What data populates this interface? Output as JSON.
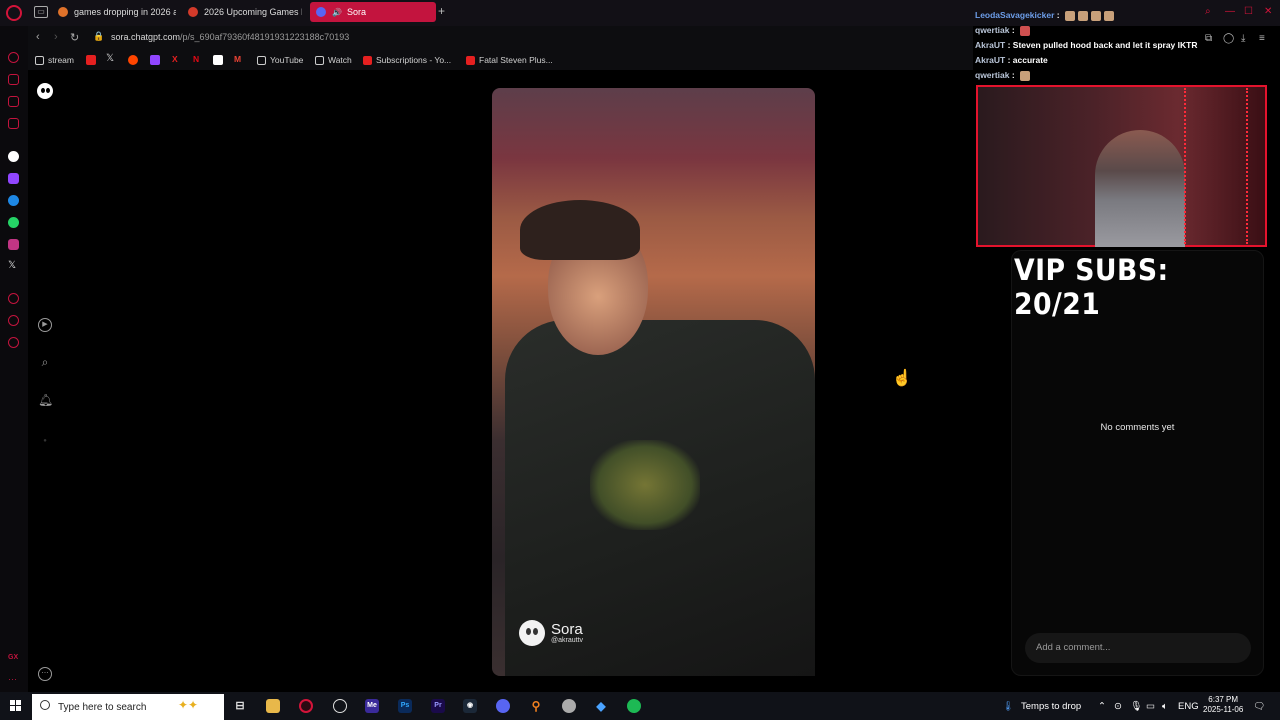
{
  "browser": {
    "tabs": [
      {
        "label": "games dropping in 2026 a",
        "icon": "reddit-icon",
        "color": "#e0722a"
      },
      {
        "label": "2026 Upcoming Games R",
        "icon": "gamespot-icon",
        "color": "#d33a2a"
      },
      {
        "label": "Sora",
        "icon": "discord-icon",
        "color": "#5865f2",
        "audio_icon": "speaker-icon"
      }
    ],
    "url_host": "sora.chatgpt.com",
    "url_path": "/p/s_690af79360f48191931223188c70193",
    "bookmarks": [
      {
        "label": "stream",
        "icon": "folder-icon"
      },
      {
        "label": "YouTube",
        "icon": "folder-icon"
      },
      {
        "label": "Watch",
        "icon": "folder-icon"
      },
      {
        "label": "Subscriptions - Yo...",
        "icon": "youtube-icon"
      },
      {
        "label": "Fatal Steven Plus...",
        "icon": "youtube-icon"
      }
    ]
  },
  "sora": {
    "watermark_brand": "Sora",
    "watermark_handle": "@akrauttv",
    "no_comments": "No comments yet",
    "comment_placeholder": "Add a comment..."
  },
  "stream_overlay": {
    "chat": [
      {
        "user": "LeodaSavagekicker",
        "msg": "",
        "name_color": "#6d9eea"
      },
      {
        "user": "qwertiak",
        "msg": "",
        "name_color": "#b9c5d8"
      },
      {
        "user": "AkraUT",
        "msg": "Steven pulled hood back and let it spray IKTR",
        "name_color": "#b9c5d8"
      },
      {
        "user": "AkraUT",
        "msg": "accurate",
        "name_color": "#b9c5d8"
      },
      {
        "user": "qwertiak",
        "msg": "",
        "name_color": "#b9c5d8"
      }
    ],
    "vip_subs": "VIP SUBS: 20/21"
  },
  "taskbar": {
    "search_placeholder": "Type here to search",
    "weather": "Temps to drop",
    "language": "ENG",
    "time": "6:37 PM",
    "date": "2025-11-06"
  },
  "colors": {
    "accent": "#c3143e",
    "webcam_border": "#e4132d"
  }
}
